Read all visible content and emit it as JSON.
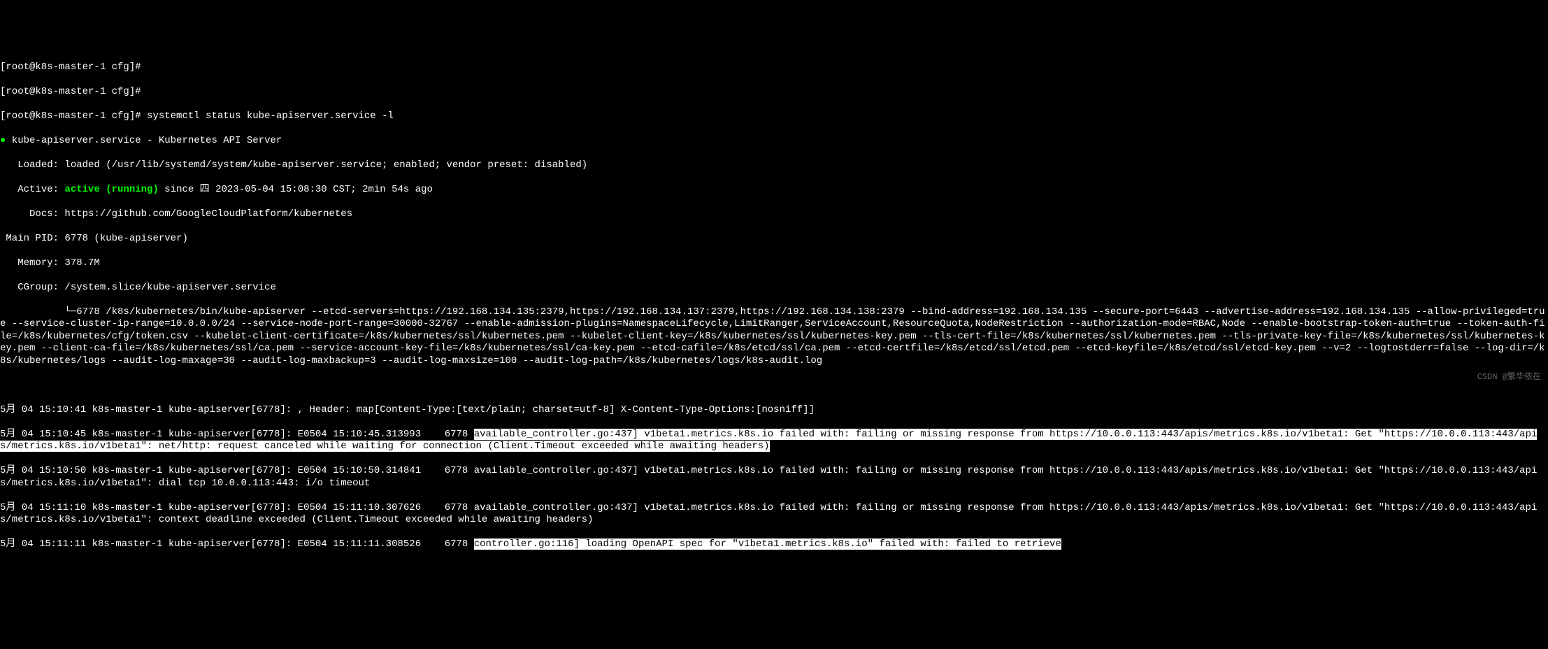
{
  "prompt1": "[root@k8s-master-1 cfg]#",
  "prompt2": "[root@k8s-master-1 cfg]#",
  "prompt3": "[root@k8s-master-1 cfg]# ",
  "command": "systemctl status kube-apiserver.service -l",
  "dot": "●",
  "service_header": " kube-apiserver.service - Kubernetes API Server",
  "loaded": "   Loaded: loaded (/usr/lib/systemd/system/kube-apiserver.service; enabled; vendor preset: disabled)",
  "active_prefix": "   Active: ",
  "active_status": "active (running)",
  "active_suffix": " since 四 2023-05-04 15:08:30 CST; 2min 54s ago",
  "docs": "     Docs: https://github.com/GoogleCloudPlatform/kubernetes",
  "main_pid": " Main PID: 6778 (kube-apiserver)",
  "memory": "   Memory: 378.7M",
  "cgroup": "   CGroup: /system.slice/kube-apiserver.service",
  "cgroup_detail": "           └─6778 /k8s/kubernetes/bin/kube-apiserver --etcd-servers=https://192.168.134.135:2379,https://192.168.134.137:2379,https://192.168.134.138:2379 --bind-address=192.168.134.135 --secure-port=6443 --advertise-address=192.168.134.135 --allow-privileged=true --service-cluster-ip-range=10.0.0.0/24 --service-node-port-range=30000-32767 --enable-admission-plugins=NamespaceLifecycle,LimitRanger,ServiceAccount,ResourceQuota,NodeRestriction --authorization-mode=RBAC,Node --enable-bootstrap-token-auth=true --token-auth-file=/k8s/kubernetes/cfg/token.csv --kubelet-client-certificate=/k8s/kubernetes/ssl/kubernetes.pem --kubelet-client-key=/k8s/kubernetes/ssl/kubernetes-key.pem --tls-cert-file=/k8s/kubernetes/ssl/kubernetes.pem --tls-private-key-file=/k8s/kubernetes/ssl/kubernetes-key.pem --client-ca-file=/k8s/kubernetes/ssl/ca.pem --service-account-key-file=/k8s/kubernetes/ssl/ca-key.pem --etcd-cafile=/k8s/etcd/ssl/ca.pem --etcd-certfile=/k8s/etcd/ssl/etcd.pem --etcd-keyfile=/k8s/etcd/ssl/etcd-key.pem --v=2 --logtostderr=false --log-dir=/k8s/kubernetes/logs --audit-log-maxage=30 --audit-log-maxbackup=3 --audit-log-maxsize=100 --audit-log-path=/k8s/kubernetes/logs/k8s-audit.log",
  "blank": " ",
  "log1": "5月 04 15:10:41 k8s-master-1 kube-apiserver[6778]: , Header: map[Content-Type:[text/plain; charset=utf-8] X-Content-Type-Options:[nosniff]]",
  "log2_a": "5月 04 15:10:45 k8s-master-1 kube-apiserver[6778]: E0504 15:10:45.313993    6778 ",
  "log2_hl": "available_controller.go:437] v1beta1.metrics.k8s.io failed with: failing or missing response from https://10.0.0.113:443/apis/metrics.k8s.io/v1beta1: Get \"https://10.0.0.113:443/apis/metrics.k8s.io/v1beta1\": net/http: request canceled while waiting for connection (Client.Timeout exceeded while awaiting headers)",
  "log3": "5月 04 15:10:50 k8s-master-1 kube-apiserver[6778]: E0504 15:10:50.314841    6778 available_controller.go:437] v1beta1.metrics.k8s.io failed with: failing or missing response from https://10.0.0.113:443/apis/metrics.k8s.io/v1beta1: Get \"https://10.0.0.113:443/apis/metrics.k8s.io/v1beta1\": dial tcp 10.0.0.113:443: i/o timeout",
  "log4": "5月 04 15:11:10 k8s-master-1 kube-apiserver[6778]: E0504 15:11:10.307626    6778 available_controller.go:437] v1beta1.metrics.k8s.io failed with: failing or missing response from https://10.0.0.113:443/apis/metrics.k8s.io/v1beta1: Get \"https://10.0.0.113:443/apis/metrics.k8s.io/v1beta1\": context deadline exceeded (Client.Timeout exceeded while awaiting headers)",
  "log5_a": "5月 04 15:11:11 k8s-master-1 kube-apiserver[6778]: E0504 15:11:11.308526    6778 ",
  "log5_hl": "controller.go:116] loading OpenAPI spec for \"v1beta1.metrics.k8s.io\" failed with: failed to retrieve",
  "watermark": "CSDN @繁华依在"
}
